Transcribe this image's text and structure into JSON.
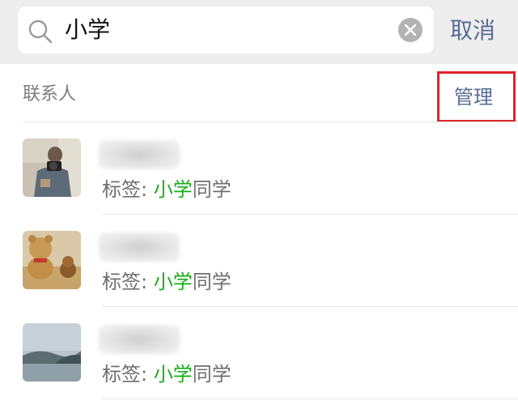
{
  "search": {
    "query": "小学",
    "cancel_label": "取消"
  },
  "section": {
    "title": "联系人",
    "manage_label": "管理"
  },
  "colors": {
    "accent_link": "#576b95",
    "match_highlight": "#1aad19",
    "highlight_box": "#e0232a"
  },
  "contacts": [
    {
      "tag_prefix": "标签: ",
      "tag_match": "小学",
      "tag_suffix": "同学",
      "avatar": "person-with-camera-avatar"
    },
    {
      "tag_prefix": "标签: ",
      "tag_match": "小学",
      "tag_suffix": "同学",
      "avatar": "teddy-bear-avatar"
    },
    {
      "tag_prefix": "标签: ",
      "tag_match": "小学",
      "tag_suffix": "同学",
      "avatar": "lake-landscape-avatar"
    }
  ]
}
